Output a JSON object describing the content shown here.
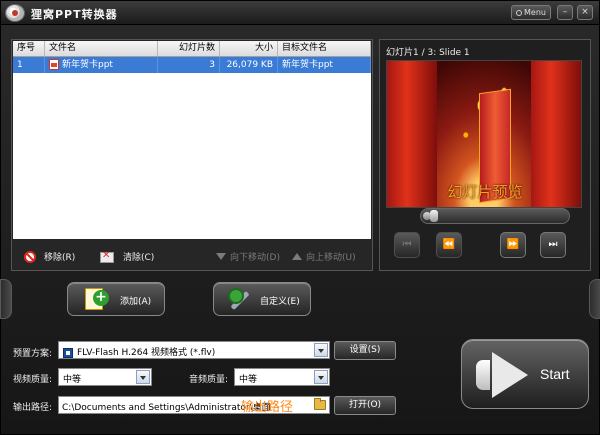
{
  "window": {
    "title": "狸窝PPT转换器",
    "menu_label": "Menu",
    "minimize_glyph": "–",
    "close_glyph": "×"
  },
  "list": {
    "columns": [
      "序号",
      "文件名",
      "幻灯片数",
      "大小",
      "目标文件名"
    ],
    "rows": [
      {
        "index": "1",
        "filename": "新年贺卡ppt",
        "slides": "3",
        "size": "26,079 KB",
        "target": "新年贺卡ppt"
      }
    ]
  },
  "list_actions": {
    "remove": "移除(R)",
    "clear": "清除(C)",
    "move_down": "向下移动(D)",
    "move_up": "向上移动(U)"
  },
  "preview": {
    "slide_info": "幻灯片1 / 3: Slide 1",
    "caption": "幻灯片预览",
    "progress_fraction": 0.05
  },
  "buttons": {
    "add": "添加(A)",
    "customize": "自定义(E)",
    "settings": "设置(S)",
    "open": "打开(O)",
    "start": "Start"
  },
  "settings": {
    "preset_label": "预置方案:",
    "preset_value": "FLV-Flash H.264 视频格式 (*.flv)",
    "video_quality_label": "视频质量:",
    "video_quality_value": "中等",
    "audio_quality_label": "音频质量:",
    "audio_quality_value": "中等",
    "output_label": "输出路径:",
    "output_value": "C:\\Documents and Settings\\Administrator\\桌面",
    "output_hint": "输出路径"
  }
}
